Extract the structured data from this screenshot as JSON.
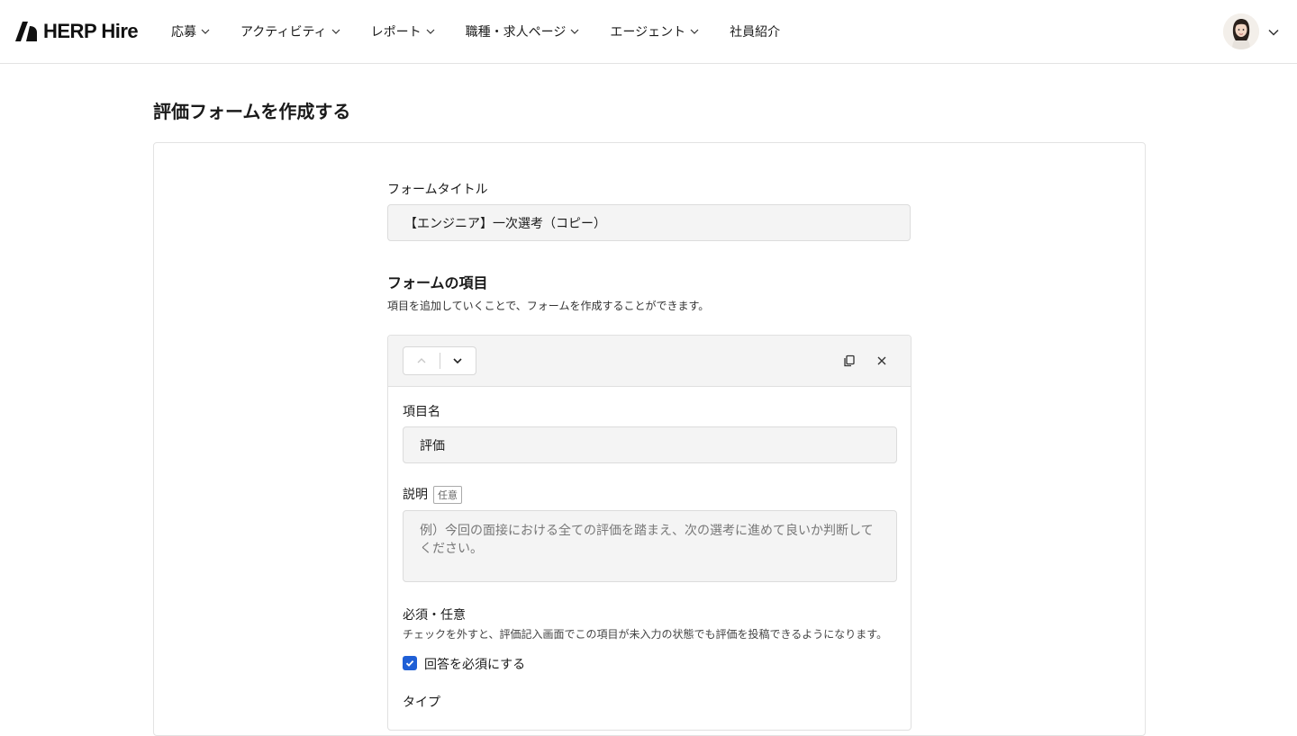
{
  "app": {
    "logo_text": "HERP Hire"
  },
  "nav": {
    "items": [
      {
        "label": "応募"
      },
      {
        "label": "アクティビティ"
      },
      {
        "label": "レポート"
      },
      {
        "label": "職種・求人ページ"
      },
      {
        "label": "エージェント"
      },
      {
        "label": "社員紹介"
      }
    ]
  },
  "page": {
    "title": "評価フォームを作成する"
  },
  "form": {
    "title_label": "フォームタイトル",
    "title_value": "【エンジニア】一次選考（コピー）",
    "items_title": "フォームの項目",
    "items_desc": "項目を追加していくことで、フォームを作成することができます。",
    "item": {
      "name_label": "項目名",
      "name_value": "評価",
      "desc_label": "説明",
      "desc_tag": "任意",
      "desc_placeholder": "例）今回の面接における全ての評価を踏まえ、次の選考に進めて良いか判断してください。",
      "required_label": "必須・任意",
      "required_hint": "チェックを外すと、評価記入画面でこの項目が未入力の状態でも評価を投稿できるようになります。",
      "required_checkbox_label": "回答を必須にする",
      "required_checked": true,
      "type_label": "タイプ"
    }
  },
  "colors": {
    "accent": "#1f5fd6",
    "field_bg": "#f4f4f4",
    "border": "#e3e3e3"
  }
}
